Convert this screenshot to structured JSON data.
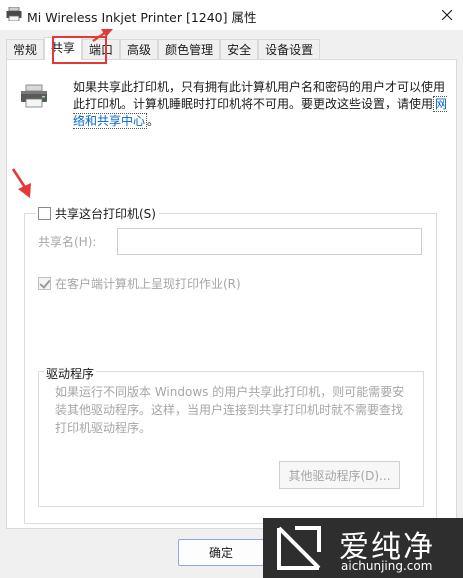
{
  "window": {
    "title": "Mi Wireless Inkjet Printer [1240] 属性"
  },
  "tabs": [
    {
      "label": "常规"
    },
    {
      "label": "共享"
    },
    {
      "label": "端口"
    },
    {
      "label": "高级"
    },
    {
      "label": "颜色管理"
    },
    {
      "label": "安全"
    },
    {
      "label": "设备设置"
    }
  ],
  "info": {
    "text": "如果共享此打印机，只有拥有此计算机用户名和密码的用户才可以使用此打印机。计算机睡眠时打印机将不可用。要更改这些设置，请使用",
    "link": "网络和共享中心",
    "suffix": "。"
  },
  "share": {
    "checkbox_label": "共享这台打印机(S)",
    "name_label": "共享名(H):",
    "name_value": "",
    "render_label": "在客户端计算机上呈现打印作业(R)"
  },
  "drivers": {
    "title": "驱动程序",
    "text": "如果运行不同版本 Windows 的用户共享此打印机，则可能需要安装其他驱动程序。这样，当用户连接到共享打印机时就不需要查找打印机驱动程序。",
    "button": "其他驱动程序(D)..."
  },
  "footer": {
    "ok": "确定"
  },
  "watermark": {
    "text": "爱纯净",
    "url": "aichunjing.com"
  },
  "colors": {
    "highlight": "#e53935",
    "link": "#0066cc",
    "disabled_text": "#a6a6a6"
  }
}
